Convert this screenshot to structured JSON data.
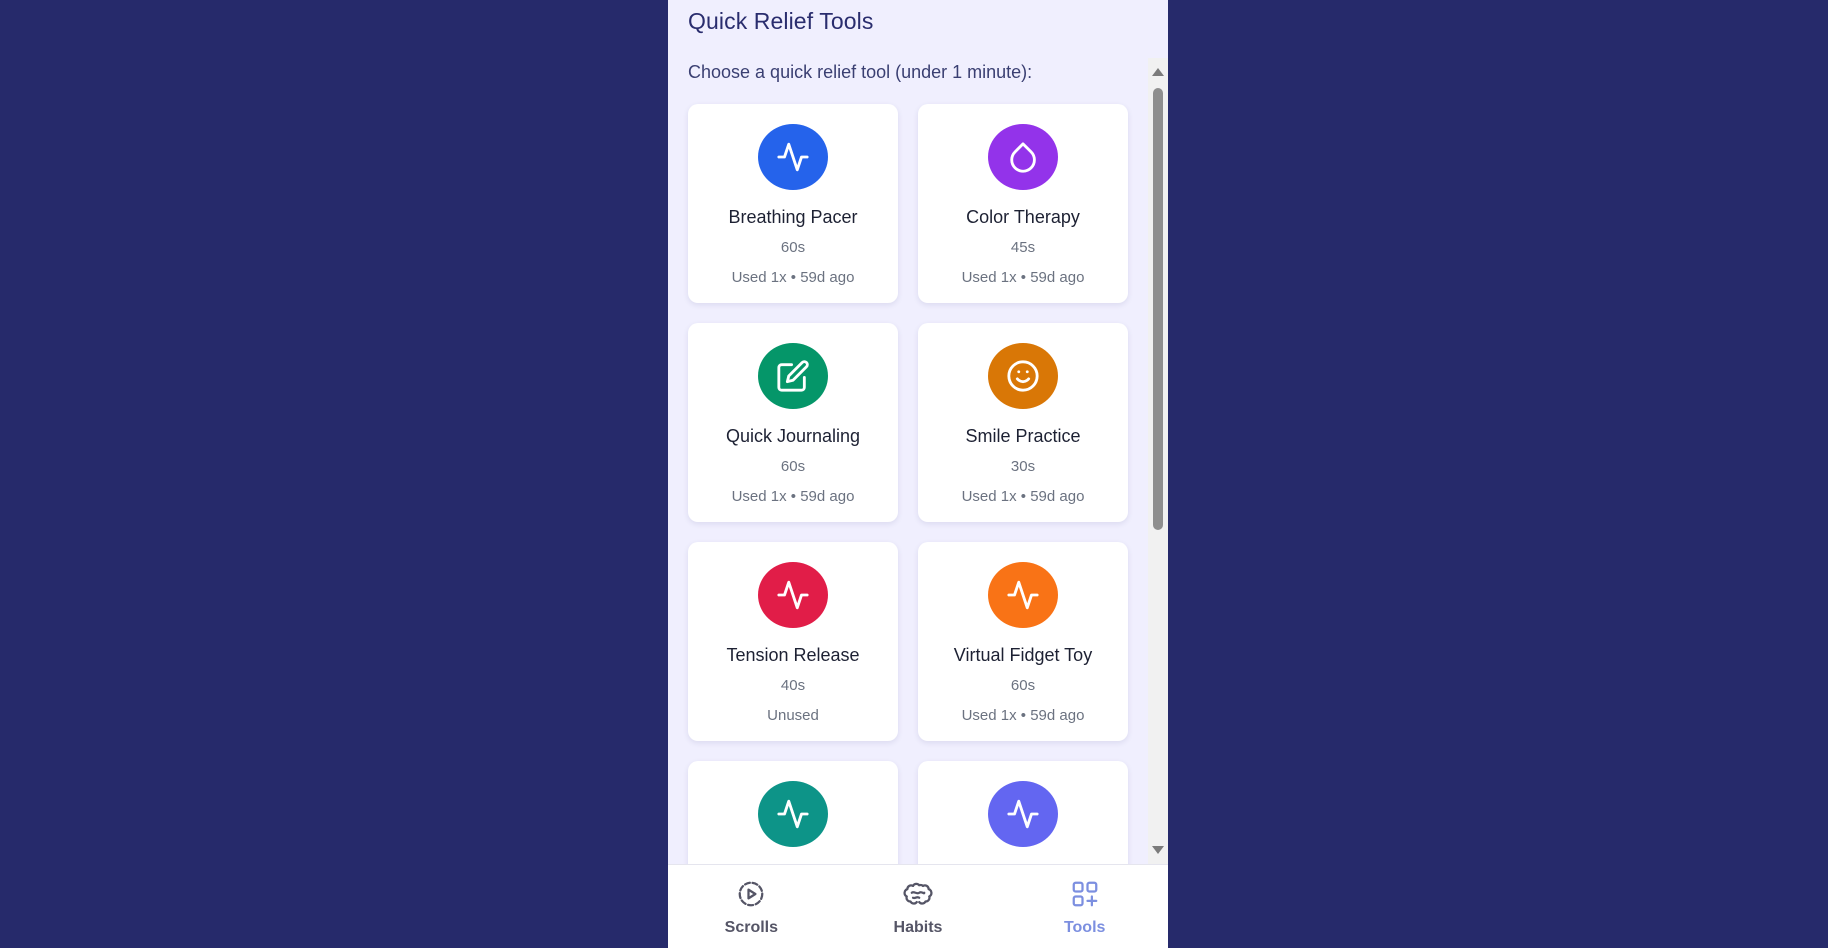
{
  "header": {
    "title": "Quick Relief Tools"
  },
  "main": {
    "subtitle": "Choose a quick relief tool (under 1 minute):",
    "tools": [
      {
        "name": "Breathing Pacer",
        "duration": "60s",
        "usage": "Used 1x  •  59d ago",
        "icon": "activity-pulse-icon",
        "color": "#2563eb"
      },
      {
        "name": "Color Therapy",
        "duration": "45s",
        "usage": "Used 1x  •  59d ago",
        "icon": "droplet-icon",
        "color": "#9333ea"
      },
      {
        "name": "Quick Journaling",
        "duration": "60s",
        "usage": "Used 1x  •  59d ago",
        "icon": "pencil-square-icon",
        "color": "#059669"
      },
      {
        "name": "Smile Practice",
        "duration": "30s",
        "usage": "Used 1x  •  59d ago",
        "icon": "smile-icon",
        "color": "#d97706"
      },
      {
        "name": "Tension Release",
        "duration": "40s",
        "usage": "Unused",
        "icon": "activity-pulse-icon",
        "color": "#e11d48"
      },
      {
        "name": "Virtual Fidget Toy",
        "duration": "60s",
        "usage": "Used 1x  •  59d ago",
        "icon": "activity-pulse-icon",
        "color": "#f97316"
      },
      {
        "name": "",
        "duration": "",
        "usage": "",
        "icon": "activity-pulse-icon",
        "color": "#0d9488"
      },
      {
        "name": "",
        "duration": "",
        "usage": "",
        "icon": "activity-pulse-icon",
        "color": "#6366f1"
      }
    ]
  },
  "nav": {
    "items": [
      {
        "label": "Scrolls",
        "icon": "play-circle-icon",
        "active": false
      },
      {
        "label": "Habits",
        "icon": "brain-icon",
        "active": false
      },
      {
        "label": "Tools",
        "icon": "grid-plus-icon",
        "active": true
      }
    ],
    "active_color": "#7c8fe0",
    "inactive_color": "#555566"
  }
}
